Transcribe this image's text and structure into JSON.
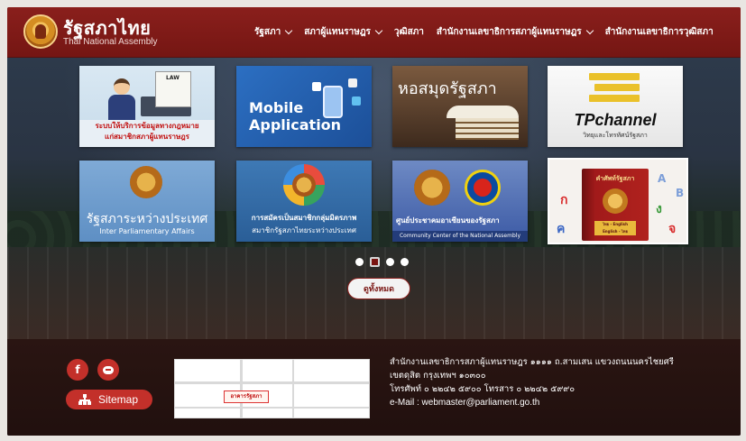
{
  "header": {
    "brand_th": "รัฐสภาไทย",
    "brand_en": "Thai National Assembly",
    "nav": [
      {
        "label": "รัฐสภา",
        "dropdown": true
      },
      {
        "label": "สภาผู้แทนราษฎร",
        "dropdown": true
      },
      {
        "label": "วุฒิสภา",
        "dropdown": false
      },
      {
        "label": "สำนักงานเลขาธิการสภาผู้แทนราษฎร",
        "dropdown": true
      },
      {
        "label": "สำนักงานเลขาธิการวุฒิสภา",
        "dropdown": false
      }
    ]
  },
  "tiles": {
    "law": {
      "doc_label": "LAW",
      "line1": "ระบบให้บริการข้อมูลทางกฎหมาย",
      "line2": "แก่สมาชิกสภาผู้แทนราษฎร"
    },
    "mobile": {
      "line1": "Mobile",
      "line2": "Application"
    },
    "library": {
      "title": "หอสมุดรัฐสภา"
    },
    "tpchannel": {
      "title": "TPchannel",
      "subtitle": "วิทยุและโทรทัศน์รัฐสภา"
    },
    "inter": {
      "title_th": "รัฐสภาระหว่างประเทศ",
      "title_en": "Inter Parliamentary Affairs"
    },
    "friendship": {
      "line1": "การสมัครเป็นสมาชิกกลุ่มมิตรภาพ",
      "line2": "สมาชิกรัฐสภาไทยระหว่างประเทศ"
    },
    "asean": {
      "line1": "ศูนย์ประชาคมอาเซียนของรัฐสภา",
      "line2": "Community Center of the National Assembly"
    },
    "dictionary": {
      "title": "คำศัพท์รัฐสภา",
      "label1": "ไทย - English",
      "label2": "English - ไทย",
      "chars": [
        "ก",
        "ค",
        "ง",
        "จ",
        "A",
        "B"
      ]
    }
  },
  "carousel": {
    "slides": 4,
    "active_index": 1
  },
  "view_all_label": "ดูทั้งหมด",
  "footer": {
    "social": {
      "facebook": "f",
      "line": "LINE"
    },
    "sitemap_label": "Sitemap",
    "map_label": "อาคารรัฐสภา",
    "address_line1": "สำนักงานเลขาธิการสภาผู้แทนราษฎร ๑๑๑๑ ถ.สามเสน แขวงถนนนครไชยศรี",
    "address_line2": "เขตดุสิต กรุงเทพฯ ๑๐๓๐๐",
    "phone_line": "โทรศัพท์ ๐ ๒๒๔๒ ๕๙๐๐   โทรสาร ๐ ๒๒๔๒ ๕๙๙๐",
    "email_line": "e-Mail : webmaster@parliament.go.th"
  },
  "colors": {
    "brand": "#8a1f1c",
    "accent": "#c3302a"
  }
}
